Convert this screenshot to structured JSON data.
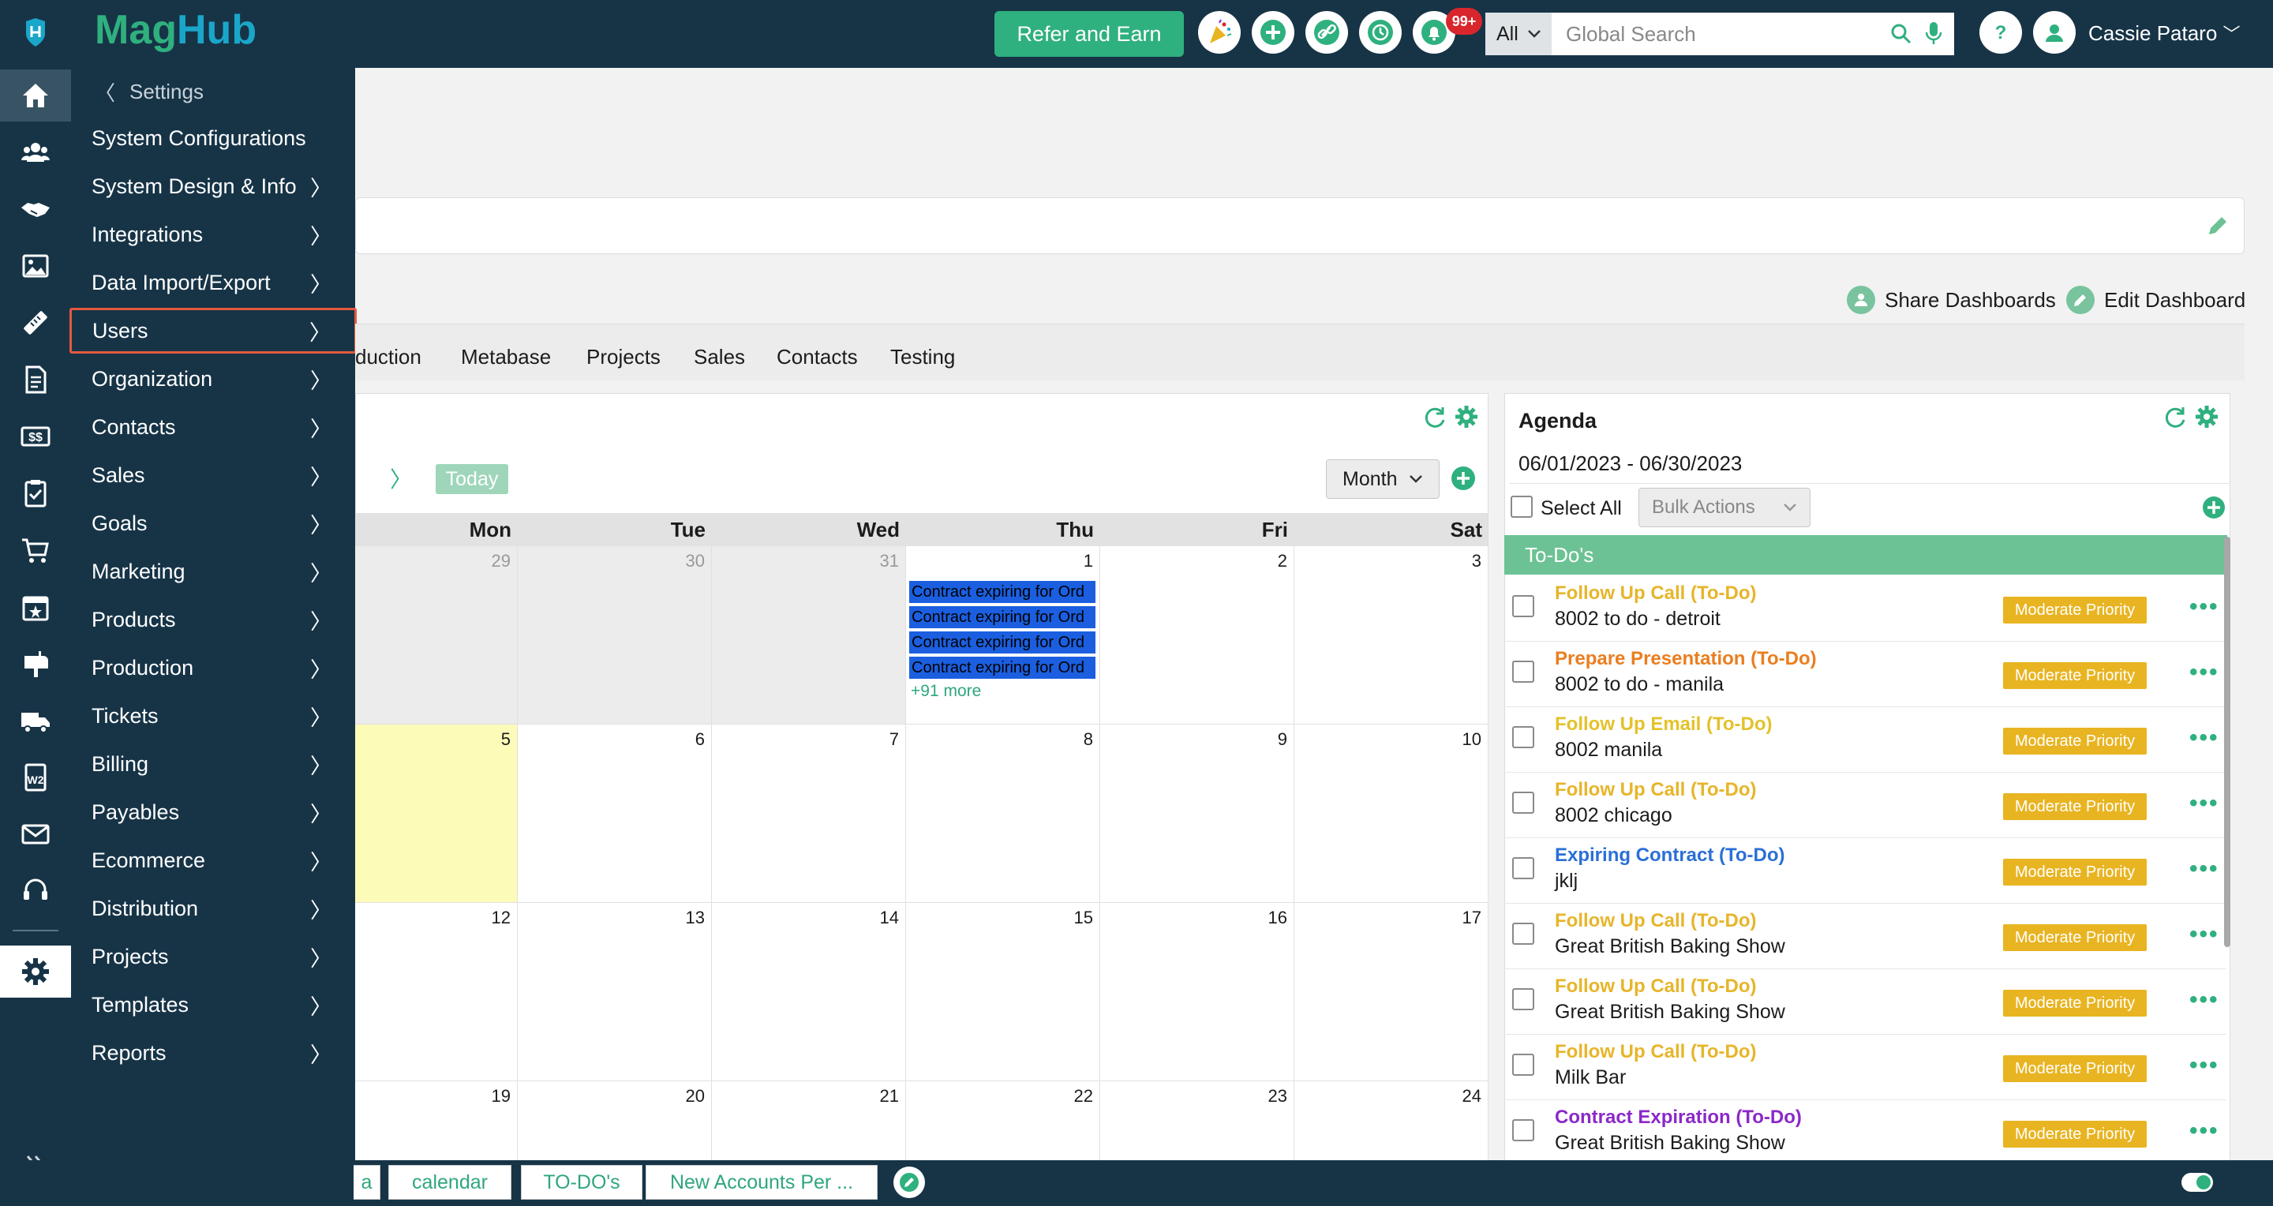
{
  "topbar": {
    "refer_label": "Refer and Earn",
    "notif_count": "99+",
    "search_scope": "All",
    "search_placeholder": "Global Search",
    "user_name": "Cassie Pataro"
  },
  "brand": {
    "part1": "Mag",
    "part2": "Hub"
  },
  "settings_menu": {
    "back_label": "Settings",
    "items": [
      {
        "label": "System Configurations",
        "arrow": ""
      },
      {
        "label": "System Design & Info",
        "arrow": "〉"
      },
      {
        "label": "Integrations",
        "arrow": "〉"
      },
      {
        "label": "Data Import/Export",
        "arrow": "〉"
      },
      {
        "label": "Users",
        "arrow": "〉"
      },
      {
        "label": "Organization",
        "arrow": "〉"
      },
      {
        "label": "Contacts",
        "arrow": "〉"
      },
      {
        "label": "Sales",
        "arrow": "〉"
      },
      {
        "label": "Goals",
        "arrow": "〉"
      },
      {
        "label": "Marketing",
        "arrow": "〉"
      },
      {
        "label": "Products",
        "arrow": "〉"
      },
      {
        "label": "Production",
        "arrow": "〉"
      },
      {
        "label": "Tickets",
        "arrow": "〉"
      },
      {
        "label": "Billing",
        "arrow": "〉"
      },
      {
        "label": "Payables",
        "arrow": "〉"
      },
      {
        "label": "Ecommerce",
        "arrow": "〉"
      },
      {
        "label": "Distribution",
        "arrow": "〉"
      },
      {
        "label": "Projects",
        "arrow": "〉"
      },
      {
        "label": "Templates",
        "arrow": "〉"
      },
      {
        "label": "Reports",
        "arrow": "〉"
      }
    ]
  },
  "dashboard": {
    "share_label": "Share Dashboards",
    "edit_label": "Edit Dashboard",
    "tabs": [
      "duction",
      "Metabase",
      "Projects",
      "Sales",
      "Contacts",
      "Testing"
    ]
  },
  "calendar": {
    "today_label": "Today",
    "view_label": "Month",
    "days": [
      "Mon",
      "Tue",
      "Wed",
      "Thu",
      "Fri",
      "Sat"
    ],
    "weeks": [
      [
        "29",
        "30",
        "31",
        "1",
        "2",
        "3"
      ],
      [
        "5",
        "6",
        "7",
        "8",
        "9",
        "10"
      ],
      [
        "12",
        "13",
        "14",
        "15",
        "16",
        "17"
      ],
      [
        "19",
        "20",
        "21",
        "22",
        "23",
        "24"
      ]
    ],
    "events": [
      "Contract expiring for Ord",
      "Contract expiring for Ord",
      "Contract expiring for Ord",
      "Contract expiring for Ord"
    ],
    "more_label": "+91 more"
  },
  "agenda": {
    "title": "Agenda",
    "range": "06/01/2023 - 06/30/2023",
    "select_all": "Select All",
    "bulk_label": "Bulk Actions",
    "group_label": "To-Do's",
    "items": [
      {
        "title": "Follow Up Call (To-Do)",
        "sub": "8002 to do - detroit",
        "priority": "Moderate Priority",
        "color": "#e7b52a"
      },
      {
        "title": "Prepare Presentation (To-Do)",
        "sub": "8002 to do - manila",
        "priority": "Moderate Priority",
        "color": "#ea7e1f"
      },
      {
        "title": "Follow Up Email (To-Do)",
        "sub": "8002 manila",
        "priority": "Moderate Priority",
        "color": "#e3c22a"
      },
      {
        "title": "Follow Up Call (To-Do)",
        "sub": "8002 chicago",
        "priority": "Moderate Priority",
        "color": "#e7b52a"
      },
      {
        "title": "Expiring Contract (To-Do)",
        "sub": "jklj",
        "priority": "Moderate Priority",
        "color": "#2b6fd6"
      },
      {
        "title": "Follow Up Call (To-Do)",
        "sub": "Great British Baking Show",
        "priority": "Moderate Priority",
        "color": "#e7b52a"
      },
      {
        "title": "Follow Up Call (To-Do)",
        "sub": "Great British Baking Show",
        "priority": "Moderate Priority",
        "color": "#e7b52a"
      },
      {
        "title": "Follow Up Call (To-Do)",
        "sub": "Milk Bar",
        "priority": "Moderate Priority",
        "color": "#e7b52a"
      },
      {
        "title": "Contract Expiration (To-Do)",
        "sub": "Great British Baking Show",
        "priority": "Moderate Priority",
        "color": "#8b28c9"
      }
    ]
  },
  "bottom_tabs": [
    "a",
    "calendar",
    "TO-DO's",
    "New Accounts Per ..."
  ],
  "colors": {
    "brand_green": "#2fb07f",
    "nav_dark": "#173447",
    "highlight": "#e3583d"
  }
}
